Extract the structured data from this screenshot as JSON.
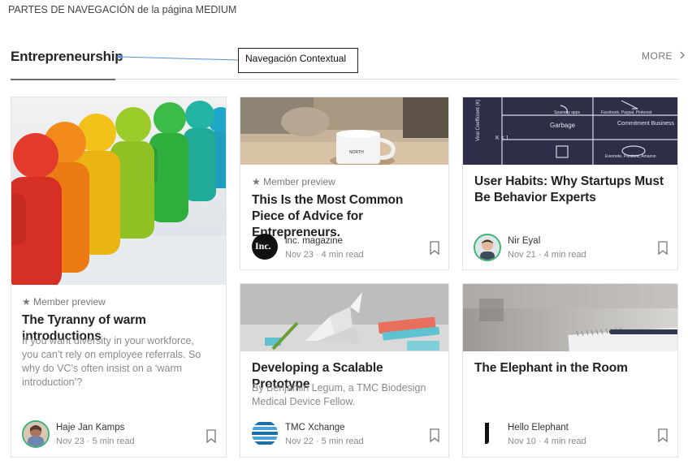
{
  "header": {
    "caption": "PARTES DE NAVEGACIÓN de la página MEDIUM"
  },
  "section": {
    "title": "Entrepreneurship",
    "more_label": "MORE",
    "more_icon": "chevron-right-icon"
  },
  "callout": {
    "label": "Navegación Contextual"
  },
  "cards": [
    {
      "preview": "★ Member preview",
      "title": "The Tyranny of warm introductions",
      "subtitle": "If you want diversity in your workforce, you can’t rely on employee referrals. So why do VC’s often insist on a ‘warm introduction’?",
      "author": "Haje Jan Kamps",
      "date": "Nov 23 · 5 min read",
      "image": "colorful-wooden-figures"
    },
    {
      "preview": "★ Member preview",
      "title": "This Is the Most Common Piece of Advice for Entrepreneurs.",
      "author": "inc. magazine",
      "avatar_text": "Inc.",
      "date": "Nov 23 · 4 min read",
      "image": "coffee-mug"
    },
    {
      "title": "User Habits: Why Startups Must Be Behavior Experts",
      "author": "Nir Eyal",
      "date": "Nov 21 · 4 min read",
      "image": "chalkboard-diagram",
      "chalk_labels": [
        "Viral Coefficient (K)",
        "Spammy apps",
        "Facebook, Paypal, Pinterest",
        "K < 1",
        "Garbage",
        "Commitment Business",
        "Evernote, Pandora, Amazon"
      ]
    },
    {
      "title": "Developing a Scalable Prototype",
      "subtitle": "By Benjamin Legum, a TMC Biodesign Medical Device Fellow.",
      "author": "TMC Xchange",
      "date": "Nov 22 · 5 min read",
      "image": "paper-crane"
    },
    {
      "title": "The Elephant in the Room",
      "author": "Hello Elephant",
      "date": "Nov 10 · 4 min read",
      "image": "notebook-pen"
    }
  ],
  "colors": {
    "text": "#222222",
    "muted": "#8a8a8a",
    "border": "#e3e3e3",
    "avatar_ring": "#3cb371"
  }
}
